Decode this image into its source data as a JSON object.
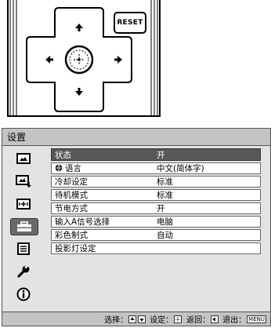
{
  "remote": {
    "reset_label": "RESET",
    "buttons": [
      "up-arrow",
      "down-arrow",
      "left-arrow",
      "right-arrow",
      "enter"
    ]
  },
  "menu": {
    "title": "设置",
    "sidebar": [
      {
        "icon": "picture-icon",
        "selected": false
      },
      {
        "icon": "picture-adjust-icon",
        "selected": false
      },
      {
        "icon": "screen-icon",
        "selected": false
      },
      {
        "icon": "setup-toolbox-icon",
        "selected": true
      },
      {
        "icon": "function-menu-icon",
        "selected": false
      },
      {
        "icon": "wrench-icon",
        "selected": false
      },
      {
        "icon": "info-icon",
        "selected": false
      }
    ],
    "items": [
      {
        "label": "状态",
        "value": "开",
        "selected": true
      },
      {
        "label": "语言",
        "value": "中文(简体字)",
        "selected": false,
        "icon": "globe-icon"
      },
      {
        "label": "冷却设定",
        "value": "标准",
        "selected": false
      },
      {
        "label": "待机模式",
        "value": "标准",
        "selected": false
      },
      {
        "label": "节电方式",
        "value": "开",
        "selected": false
      },
      {
        "label": "输入A信号选择",
        "value": "电脑",
        "selected": false
      },
      {
        "label": "彩色制式",
        "value": "自动",
        "selected": false
      },
      {
        "label": "投影灯设定",
        "value": "",
        "selected": false
      }
    ],
    "footer": {
      "select": "选择：",
      "set": "设定：",
      "back": "返回：",
      "exit": "退出：",
      "menu_key": "MENU"
    }
  }
}
